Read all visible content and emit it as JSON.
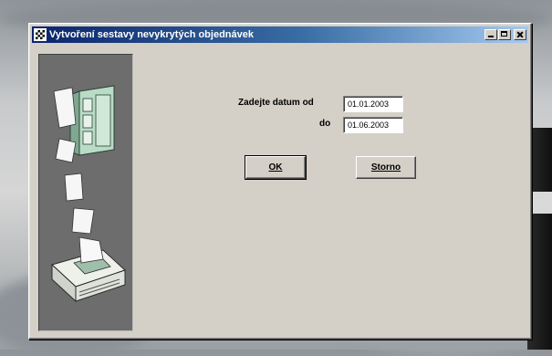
{
  "window": {
    "title": "Vytvoření sestavy nevykrytých objednávek",
    "minimize_icon": "minimize-icon",
    "maximize_icon": "maximize-icon",
    "close_icon": "close-icon"
  },
  "form": {
    "date_from_label": "Zadejte datum od",
    "date_from_value": "01.01.2003",
    "date_to_label": "do",
    "date_to_value": "01.06.2003"
  },
  "buttons": {
    "ok_label": "OK",
    "cancel_label": "Storno"
  },
  "illustration": {
    "icon": "printer-papers-illustration"
  },
  "colors": {
    "titlebar_start": "#0a246a",
    "titlebar_end": "#a6caf0",
    "window_face": "#d4d0c8",
    "panel": "#6d6d6d"
  }
}
